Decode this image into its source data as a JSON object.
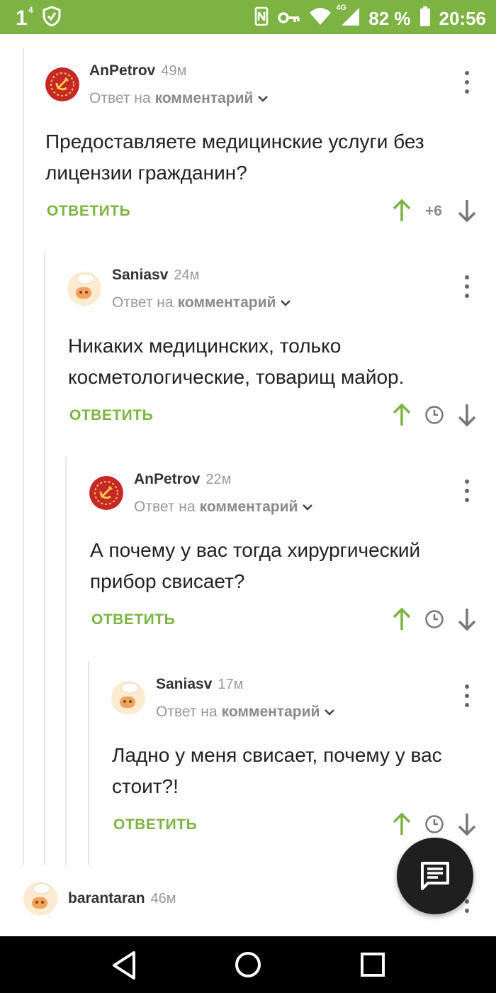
{
  "status_bar": {
    "notif_count": "1",
    "notif_sup": "4",
    "network": "4G",
    "battery": "82 %",
    "time": "20:56"
  },
  "comments": [
    {
      "author": "AnPetrov",
      "time": "49м",
      "reply_prefix": "Ответ на",
      "reply_target": "комментарий",
      "text": "Предоставляете медицинские услуги без лицензии гражданин?",
      "reply_label": "ОТВЕТИТЬ",
      "rating": "+6"
    },
    {
      "author": "Saniasv",
      "time": "24м",
      "reply_prefix": "Ответ на",
      "reply_target": "комментарий",
      "text": "Никаких медицинских, только косметологические, товарищ майор.",
      "reply_label": "ОТВЕТИТЬ"
    },
    {
      "author": "AnPetrov",
      "time": "22м",
      "reply_prefix": "Ответ на",
      "reply_target": "комментарий",
      "text": "А почему у вас тогда хирургический прибор свисает?",
      "reply_label": "ОТВЕТИТЬ"
    },
    {
      "author": "Saniasv",
      "time": "17м",
      "reply_prefix": "Ответ на",
      "reply_target": "комментарий",
      "text": "Ладно у меня свисает, почему у вас стоит?!",
      "reply_label": "ОТВЕТИТЬ"
    },
    {
      "author": "barantaran",
      "time": "46м"
    }
  ],
  "colors": {
    "accent": "#7cb342",
    "fab": "#1f1f1f"
  },
  "icons": {
    "fab": "chat-icon",
    "upvote": "arrow-up-icon",
    "downvote": "arrow-down-icon",
    "save": "clock-icon",
    "menu": "more-vertical-icon"
  }
}
